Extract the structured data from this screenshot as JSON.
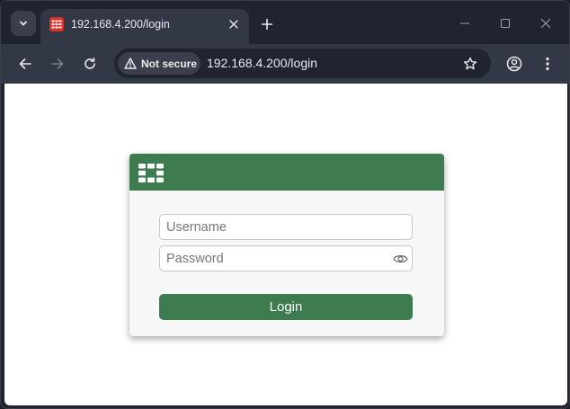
{
  "browser": {
    "tab": {
      "title": "192.168.4.200/login"
    },
    "omnibox": {
      "security_label": "Not secure",
      "url": "192.168.4.200/login"
    }
  },
  "login": {
    "username_placeholder": "Username",
    "password_placeholder": "Password",
    "login_label": "Login"
  },
  "colors": {
    "brand_green": "#3e7b4e",
    "favicon_red": "#d8322a",
    "chrome_dark": "#202430",
    "toolbar": "#323846"
  },
  "icons": [
    "tab-search-icon",
    "fortinet-favicon-icon",
    "close-icon",
    "plus-icon",
    "minimize-icon",
    "maximize-icon",
    "window-close-icon",
    "back-arrow-icon",
    "forward-arrow-icon",
    "reload-icon",
    "warning-icon",
    "star-icon",
    "profile-icon",
    "kebab-menu-icon",
    "fortinet-logo-icon",
    "eye-icon"
  ]
}
